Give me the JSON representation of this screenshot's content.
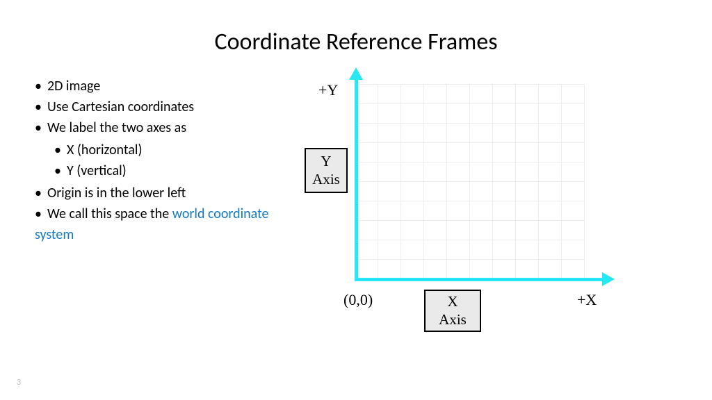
{
  "title": "Coordinate Reference Frames",
  "bullets": {
    "b1": "2D image",
    "b2": "Use Cartesian coordinates",
    "b3": "We label the two axes as",
    "b3a": "X (horizontal)",
    "b3b": "Y (vertical)",
    "b4": "Origin is in the lower left",
    "b5_pre": "We call this space the ",
    "b5_link": "world coordinate system"
  },
  "diagram": {
    "plus_y": "+Y",
    "plus_x": "+X",
    "origin": "(0,0)",
    "y_axis_box_l1": "Y",
    "y_axis_box_l2": "Axis",
    "x_axis_box_l1": "X",
    "x_axis_box_l2": "Axis"
  },
  "page_number": "3",
  "chart_data": {
    "type": "diagram",
    "description": "Cartesian 2D coordinate frame illustration",
    "axes": [
      {
        "name": "X",
        "direction": "horizontal",
        "positive_label": "+X"
      },
      {
        "name": "Y",
        "direction": "vertical",
        "positive_label": "+Y"
      }
    ],
    "origin_label": "(0,0)",
    "origin_position": "lower-left",
    "axis_color": "#28e7f5",
    "grid": true
  }
}
